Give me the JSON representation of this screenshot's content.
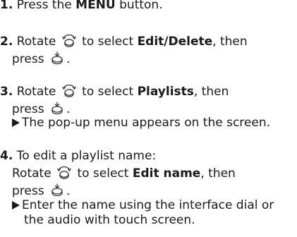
{
  "step1": {
    "num": "1.",
    "text_a": "Press the ",
    "bold": "MENU",
    "text_b": " button."
  },
  "step2": {
    "num": "2.",
    "text_a": "Rotate ",
    "text_b": " to select ",
    "bold": "Edit/Delete",
    "text_c": ", then",
    "text_d": "press ",
    "text_e": "."
  },
  "step3": {
    "num": "3.",
    "text_a": "Rotate ",
    "text_b": " to select ",
    "bold": "Playlists",
    "text_c": ", then",
    "text_d": "press ",
    "text_e": ".",
    "result": "The pop-up menu appears on the screen."
  },
  "step4": {
    "num": "4.",
    "intro": "To edit a playlist name:",
    "text_a": "Rotate ",
    "text_b": " to select ",
    "bold": "Edit name",
    "text_c": ", then",
    "text_d": "press ",
    "text_e": ".",
    "result_line1": "Enter the name using the interface dial or",
    "result_line2": "the audio with touch screen."
  },
  "icons": {
    "rotate": "interface-dial-rotate-icon",
    "press": "interface-dial-press-icon",
    "result": "result-arrow-icon"
  }
}
